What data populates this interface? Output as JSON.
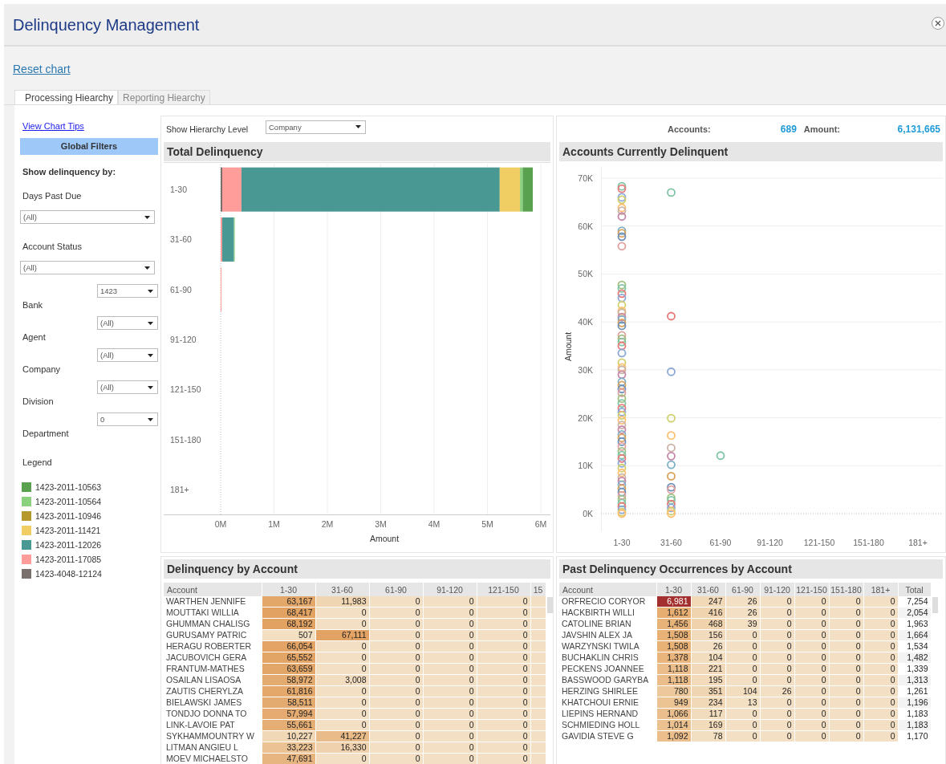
{
  "window": {
    "title": "Delinquency Management"
  },
  "reset_link": "Reset chart",
  "tabs": [
    {
      "label": "Processing Hiearchy",
      "selected": true
    },
    {
      "label": "Reporting Hiearchy",
      "selected": false
    }
  ],
  "sidebar": {
    "tips_link": "View Chart Tips",
    "filters_title": "Global Filters",
    "show_by": "Show delinquency by:",
    "filters": [
      {
        "label": "Days Past Due",
        "value": "(All)",
        "kind": "wide"
      },
      {
        "label": "Account Status",
        "value": "(All)",
        "kind": "wide"
      },
      {
        "label": "Bank",
        "value": "1423",
        "kind": "inline"
      },
      {
        "label": "Agent",
        "value": "(All)",
        "kind": "inline"
      },
      {
        "label": "Company",
        "value": "(All)",
        "kind": "inline"
      },
      {
        "label": "Division",
        "value": "(All)",
        "kind": "inline"
      },
      {
        "label": "Department",
        "value": "0",
        "kind": "inline"
      }
    ],
    "legend_title": "Legend"
  },
  "hierarchy": {
    "label": "Show Hierarchy Level",
    "value": "Company"
  },
  "total_delinquency": {
    "title": "Total Delinquency",
    "chart_data": {
      "type": "bar",
      "orientation": "horizontal",
      "stacked": true,
      "grid": true,
      "xlabel": "Amount",
      "categories": [
        "1-30",
        "31-60",
        "61-90",
        "91-120",
        "121-150",
        "151-180",
        "181+"
      ],
      "xlim": [
        0,
        6
      ],
      "xticks": [
        {
          "value": 0,
          "label": "0M"
        },
        {
          "value": 1,
          "label": "1M"
        },
        {
          "value": 2,
          "label": "2M"
        },
        {
          "value": 3,
          "label": "3M"
        },
        {
          "value": 4,
          "label": "4M"
        },
        {
          "value": 5,
          "label": "5M"
        },
        {
          "value": 6,
          "label": "6M"
        }
      ],
      "series": [
        {
          "name": "1423-2011-10563",
          "color": "#59a14f",
          "values": [
            0.19,
            0,
            0,
            0,
            0,
            0,
            0
          ]
        },
        {
          "name": "1423-2011-10564",
          "color": "#8cd17d",
          "values": [
            0.05,
            0.01,
            0,
            0,
            0,
            0,
            0
          ]
        },
        {
          "name": "1423-2011-10946",
          "color": "#b6992d",
          "values": [
            0,
            0,
            0,
            0,
            0,
            0,
            0
          ]
        },
        {
          "name": "1423-2011-11421",
          "color": "#f1ce63",
          "values": [
            0.38,
            0,
            0,
            0,
            0,
            0,
            0
          ]
        },
        {
          "name": "1423-2011-12026",
          "color": "#499894",
          "values": [
            4.84,
            0.22,
            0,
            0,
            0,
            0,
            0
          ]
        },
        {
          "name": "1423-2011-17085",
          "color": "#ff9d9a",
          "values": [
            0.36,
            0.03,
            0.01,
            0,
            0,
            0,
            0
          ]
        },
        {
          "name": "1423-4048-12124",
          "color": "#79706e",
          "values": [
            0.03,
            0,
            0,
            0,
            0,
            0,
            0
          ]
        }
      ]
    }
  },
  "summary": {
    "accounts_label": "Accounts:",
    "accounts": "689",
    "amount_label": "Amount:",
    "amount": "6,131,665"
  },
  "accounts_delinquent": {
    "title": "Accounts Currently Delinquent",
    "chart_data": {
      "type": "scatter",
      "grid": true,
      "ylabel": "Amount",
      "categories": [
        "1-30",
        "31-60",
        "61-90",
        "91-120",
        "121-150",
        "151-180",
        "181+"
      ],
      "ylim": [
        0,
        70000
      ],
      "yticks": [
        {
          "value": 0,
          "label": "0K"
        },
        {
          "value": 10000,
          "label": "10K"
        },
        {
          "value": 20000,
          "label": "20K"
        },
        {
          "value": 30000,
          "label": "30K"
        },
        {
          "value": 40000,
          "label": "40K"
        },
        {
          "value": 50000,
          "label": "50K"
        },
        {
          "value": 60000,
          "label": "60K"
        },
        {
          "value": 70000,
          "label": "70K"
        }
      ],
      "series": [
        {
          "color": "#7fc4a4",
          "values": [
            68300,
            67000,
            12100,
            null,
            null,
            null,
            null
          ]
        },
        {
          "color": "#e8787a",
          "values": [
            67800,
            41200,
            null,
            null,
            null,
            null,
            null
          ]
        },
        {
          "color": "#8aa6d6",
          "values": [
            66000,
            29600,
            null,
            null,
            null,
            null,
            null
          ]
        },
        {
          "color": "#cfcf6e",
          "values": [
            65500,
            19900,
            null,
            null,
            null,
            null,
            null
          ]
        },
        {
          "color": "#ffbe70",
          "values": [
            63800,
            16300,
            null,
            null,
            null,
            null,
            null
          ]
        },
        {
          "color": "#c9b2a8",
          "values": [
            63200,
            13700,
            null,
            null,
            null,
            null,
            null
          ]
        },
        {
          "color": "#c586a8",
          "values": [
            62000,
            12000,
            null,
            null,
            null,
            null,
            null
          ]
        },
        {
          "color": "#7fb0c4",
          "values": [
            59000,
            10200,
            null,
            null,
            null,
            null,
            null
          ]
        },
        {
          "color": "#d9a25a",
          "values": [
            58500,
            7800,
            null,
            null,
            null,
            null,
            null
          ]
        },
        {
          "color": "#6f8fb8",
          "values": [
            57800,
            5500,
            null,
            null,
            null,
            null,
            null
          ]
        },
        {
          "color": "#e0a0a0",
          "values": [
            55800,
            5000,
            null,
            null,
            null,
            null,
            null
          ]
        },
        {
          "color": "#9fbf7f",
          "values": [
            47700,
            3300,
            null,
            null,
            null,
            null,
            null
          ]
        },
        {
          "color": "#7fc4a4",
          "values": [
            47000,
            2800,
            null,
            null,
            null,
            null,
            null
          ]
        },
        {
          "color": "#e8787a",
          "values": [
            45900,
            2000,
            null,
            null,
            null,
            null,
            null
          ]
        },
        {
          "color": "#8aa6d6",
          "values": [
            45000,
            1200,
            null,
            null,
            null,
            null,
            null
          ]
        },
        {
          "color": "#cfcf6e",
          "values": [
            43500,
            500,
            null,
            null,
            null,
            null,
            null
          ]
        },
        {
          "color": "#ffbe70",
          "values": [
            42300,
            0,
            null,
            null,
            null,
            null,
            null
          ]
        },
        {
          "color": "#c9b2a8",
          "values": [
            41900,
            null,
            null,
            null,
            null,
            null,
            null
          ]
        },
        {
          "color": "#c586a8",
          "values": [
            41000,
            null,
            null,
            null,
            null,
            null,
            null
          ]
        },
        {
          "color": "#7fb0c4",
          "values": [
            40500,
            null,
            null,
            null,
            null,
            null,
            null
          ]
        },
        {
          "color": "#d9a25a",
          "values": [
            39800,
            null,
            null,
            null,
            null,
            null,
            null
          ]
        },
        {
          "color": "#6f8fb8",
          "values": [
            39200,
            null,
            null,
            null,
            null,
            null,
            null
          ]
        },
        {
          "color": "#e0a0a0",
          "values": [
            37200,
            null,
            null,
            null,
            null,
            null,
            null
          ]
        },
        {
          "color": "#9fbf7f",
          "values": [
            36500,
            null,
            null,
            null,
            null,
            null,
            null
          ]
        },
        {
          "color": "#7fc4a4",
          "values": [
            35800,
            null,
            null,
            null,
            null,
            null,
            null
          ]
        },
        {
          "color": "#e8787a",
          "values": [
            35000,
            null,
            null,
            null,
            null,
            null,
            null
          ]
        },
        {
          "color": "#8aa6d6",
          "values": [
            33500,
            null,
            null,
            null,
            null,
            null,
            null
          ]
        },
        {
          "color": "#cfcf6e",
          "values": [
            31500,
            null,
            null,
            null,
            null,
            null,
            null
          ]
        },
        {
          "color": "#ffbe70",
          "values": [
            30500,
            null,
            null,
            null,
            null,
            null,
            null
          ]
        },
        {
          "color": "#c9b2a8",
          "values": [
            30000,
            null,
            null,
            null,
            null,
            null,
            null
          ]
        },
        {
          "color": "#c586a8",
          "values": [
            29000,
            null,
            null,
            null,
            null,
            null,
            null
          ]
        },
        {
          "color": "#7fb0c4",
          "values": [
            27500,
            null,
            null,
            null,
            null,
            null,
            null
          ]
        },
        {
          "color": "#d9a25a",
          "values": [
            26800,
            null,
            null,
            null,
            null,
            null,
            null
          ]
        },
        {
          "color": "#6f8fb8",
          "values": [
            26000,
            null,
            null,
            null,
            null,
            null,
            null
          ]
        },
        {
          "color": "#e0a0a0",
          "values": [
            25200,
            null,
            null,
            null,
            null,
            null,
            null
          ]
        },
        {
          "color": "#9fbf7f",
          "values": [
            24000,
            null,
            null,
            null,
            null,
            null,
            null
          ]
        },
        {
          "color": "#7fc4a4",
          "values": [
            23000,
            null,
            null,
            null,
            null,
            null,
            null
          ]
        },
        {
          "color": "#e8787a",
          "values": [
            22000,
            null,
            null,
            null,
            null,
            null,
            null
          ]
        },
        {
          "color": "#8aa6d6",
          "values": [
            21200,
            null,
            null,
            null,
            null,
            null,
            null
          ]
        },
        {
          "color": "#cfcf6e",
          "values": [
            20500,
            null,
            null,
            null,
            null,
            null,
            null
          ]
        },
        {
          "color": "#ffbe70",
          "values": [
            19500,
            null,
            null,
            null,
            null,
            null,
            null
          ]
        },
        {
          "color": "#c9b2a8",
          "values": [
            18500,
            null,
            null,
            null,
            null,
            null,
            null
          ]
        },
        {
          "color": "#c586a8",
          "values": [
            17500,
            null,
            null,
            null,
            null,
            null,
            null
          ]
        },
        {
          "color": "#7fb0c4",
          "values": [
            16500,
            null,
            null,
            null,
            null,
            null,
            null
          ]
        },
        {
          "color": "#d9a25a",
          "values": [
            15800,
            null,
            null,
            null,
            null,
            null,
            null
          ]
        },
        {
          "color": "#6f8fb8",
          "values": [
            15000,
            null,
            null,
            null,
            null,
            null,
            null
          ]
        },
        {
          "color": "#e0a0a0",
          "values": [
            14000,
            null,
            null,
            null,
            null,
            null,
            null
          ]
        },
        {
          "color": "#9fbf7f",
          "values": [
            13000,
            null,
            null,
            null,
            null,
            null,
            null
          ]
        },
        {
          "color": "#7fc4a4",
          "values": [
            12200,
            null,
            null,
            null,
            null,
            null,
            null
          ]
        },
        {
          "color": "#e8787a",
          "values": [
            11500,
            null,
            null,
            null,
            null,
            null,
            null
          ]
        },
        {
          "color": "#8aa6d6",
          "values": [
            10500,
            null,
            null,
            null,
            null,
            null,
            null
          ]
        },
        {
          "color": "#cfcf6e",
          "values": [
            9500,
            null,
            null,
            null,
            null,
            null,
            null
          ]
        },
        {
          "color": "#ffbe70",
          "values": [
            8500,
            null,
            null,
            null,
            null,
            null,
            null
          ]
        },
        {
          "color": "#c9b2a8",
          "values": [
            7500,
            null,
            null,
            null,
            null,
            null,
            null
          ]
        },
        {
          "color": "#c586a8",
          "values": [
            6800,
            null,
            null,
            null,
            null,
            null,
            null
          ]
        },
        {
          "color": "#7fb0c4",
          "values": [
            6000,
            null,
            null,
            null,
            null,
            null,
            null
          ]
        },
        {
          "color": "#d9a25a",
          "values": [
            5200,
            null,
            null,
            null,
            null,
            null,
            null
          ]
        },
        {
          "color": "#6f8fb8",
          "values": [
            4500,
            null,
            null,
            null,
            null,
            null,
            null
          ]
        },
        {
          "color": "#e0a0a0",
          "values": [
            3800,
            null,
            null,
            null,
            null,
            null,
            null
          ]
        },
        {
          "color": "#9fbf7f",
          "values": [
            3000,
            null,
            null,
            null,
            null,
            null,
            null
          ]
        },
        {
          "color": "#7fc4a4",
          "values": [
            2200,
            null,
            null,
            null,
            null,
            null,
            null
          ]
        },
        {
          "color": "#e8787a",
          "values": [
            1500,
            null,
            null,
            null,
            null,
            null,
            null
          ]
        },
        {
          "color": "#8aa6d6",
          "values": [
            800,
            null,
            null,
            null,
            null,
            null,
            null
          ]
        },
        {
          "color": "#cfcf6e",
          "values": [
            300,
            null,
            null,
            null,
            null,
            null,
            null
          ]
        },
        {
          "color": "#ffbe70",
          "values": [
            0,
            null,
            null,
            null,
            null,
            null,
            null
          ]
        }
      ]
    }
  },
  "delinquency_by_account": {
    "title": "Delinquency by Account",
    "columns": [
      {
        "label": "Account",
        "kind": "account"
      },
      {
        "label": "1-30",
        "kind": "heat"
      },
      {
        "label": "31-60",
        "kind": "heat"
      },
      {
        "label": "61-90",
        "kind": "heat"
      },
      {
        "label": "91-120",
        "kind": "heat"
      },
      {
        "label": "121-150",
        "kind": "heat"
      },
      {
        "label": "15",
        "kind": "heat"
      }
    ],
    "rows": [
      {
        "account": "WARTHEN JENNIFE",
        "values": [
          "63,167",
          "11,983",
          "0",
          "0",
          "0"
        ]
      },
      {
        "account": "MOUTTAKI WILLIA",
        "values": [
          "68,417",
          "0",
          "0",
          "0",
          "0"
        ]
      },
      {
        "account": "GHUMMAN CHALISG",
        "values": [
          "68,192",
          "0",
          "0",
          "0",
          "0"
        ]
      },
      {
        "account": "GURUSAMY PATRIC",
        "values": [
          "507",
          "67,111",
          "0",
          "0",
          "0"
        ]
      },
      {
        "account": "HERAGU ROBERTER",
        "values": [
          "66,054",
          "0",
          "0",
          "0",
          "0"
        ]
      },
      {
        "account": "JACUBOVICH GERA",
        "values": [
          "65,552",
          "0",
          "0",
          "0",
          "0"
        ]
      },
      {
        "account": "FRANTUM-MATHES",
        "values": [
          "63,659",
          "0",
          "0",
          "0",
          "0"
        ]
      },
      {
        "account": "OSAILAN LISAOSA",
        "values": [
          "58,972",
          "3,008",
          "0",
          "0",
          "0"
        ]
      },
      {
        "account": "ZAUTIS CHERYLZA",
        "values": [
          "61,816",
          "0",
          "0",
          "0",
          "0"
        ]
      },
      {
        "account": "BIELAWSKI JAMES",
        "values": [
          "58,511",
          "0",
          "0",
          "0",
          "0"
        ]
      },
      {
        "account": "TONDJO DONNA TO",
        "values": [
          "57,994",
          "0",
          "0",
          "0",
          "0"
        ]
      },
      {
        "account": "LINK-LAVOIE PAT",
        "values": [
          "55,661",
          "0",
          "0",
          "0",
          "0"
        ]
      },
      {
        "account": "SYKHAMMOUNTRY W",
        "values": [
          "10,227",
          "41,227",
          "0",
          "0",
          "0"
        ]
      },
      {
        "account": "LITMAN ANGIEU L",
        "values": [
          "33,223",
          "16,330",
          "0",
          "0",
          "0"
        ]
      },
      {
        "account": "MOEV MICHAELSTO",
        "values": [
          "47,691",
          "0",
          "0",
          "0",
          "0"
        ]
      }
    ]
  },
  "past_delinquency": {
    "title": "Past Delinquency Occurrences by Account",
    "columns": [
      {
        "label": "Account",
        "kind": "account"
      },
      {
        "label": "1-30",
        "kind": "heat"
      },
      {
        "label": "31-60",
        "kind": "heat"
      },
      {
        "label": "61-90",
        "kind": "heat"
      },
      {
        "label": "91-120",
        "kind": "heat"
      },
      {
        "label": "121-150",
        "kind": "heat"
      },
      {
        "label": "151-180",
        "kind": "heat"
      },
      {
        "label": "181+",
        "kind": "heat"
      },
      {
        "label": "Total",
        "kind": "total"
      }
    ],
    "rows": [
      {
        "account": "ORFRECIO CORYOR",
        "values": [
          "6,981",
          "247",
          "26",
          "0",
          "0",
          "0",
          "0",
          "7,254"
        ]
      },
      {
        "account": "HACKBIRTH WILLI",
        "values": [
          "1,612",
          "416",
          "26",
          "0",
          "0",
          "0",
          "0",
          "2,054"
        ]
      },
      {
        "account": "CATOLINE BRIAN",
        "values": [
          "1,456",
          "468",
          "39",
          "0",
          "0",
          "0",
          "0",
          "1,963"
        ]
      },
      {
        "account": "JAVSHIN ALEX JA",
        "values": [
          "1,508",
          "156",
          "0",
          "0",
          "0",
          "0",
          "0",
          "1,664"
        ]
      },
      {
        "account": "WARZYNSKI TWILA",
        "values": [
          "1,508",
          "26",
          "0",
          "0",
          "0",
          "0",
          "0",
          "1,534"
        ]
      },
      {
        "account": "BUCHAKLIN CHRIS",
        "values": [
          "1,378",
          "104",
          "0",
          "0",
          "0",
          "0",
          "0",
          "1,482"
        ]
      },
      {
        "account": "PECKENS JOANNEE",
        "values": [
          "1,118",
          "221",
          "0",
          "0",
          "0",
          "0",
          "0",
          "1,339"
        ]
      },
      {
        "account": "BASSWOOD GARYBA",
        "values": [
          "1,118",
          "195",
          "0",
          "0",
          "0",
          "0",
          "0",
          "1,313"
        ]
      },
      {
        "account": "HERZING SHIRLEE",
        "values": [
          "780",
          "351",
          "104",
          "26",
          "0",
          "0",
          "0",
          "1,261"
        ]
      },
      {
        "account": "KHATCHOUI ERNIE",
        "values": [
          "949",
          "234",
          "13",
          "0",
          "0",
          "0",
          "0",
          "1,196"
        ]
      },
      {
        "account": "LIEPINS HERNAND",
        "values": [
          "1,066",
          "117",
          "0",
          "0",
          "0",
          "0",
          "0",
          "1,183"
        ]
      },
      {
        "account": "SCHMIEDING HOLL",
        "values": [
          "1,014",
          "169",
          "0",
          "0",
          "0",
          "0",
          "0",
          "1,183"
        ]
      },
      {
        "account": "GAVIDIA STEVE G",
        "values": [
          "1,092",
          "78",
          "0",
          "0",
          "0",
          "0",
          "0",
          "1,170"
        ]
      }
    ]
  }
}
